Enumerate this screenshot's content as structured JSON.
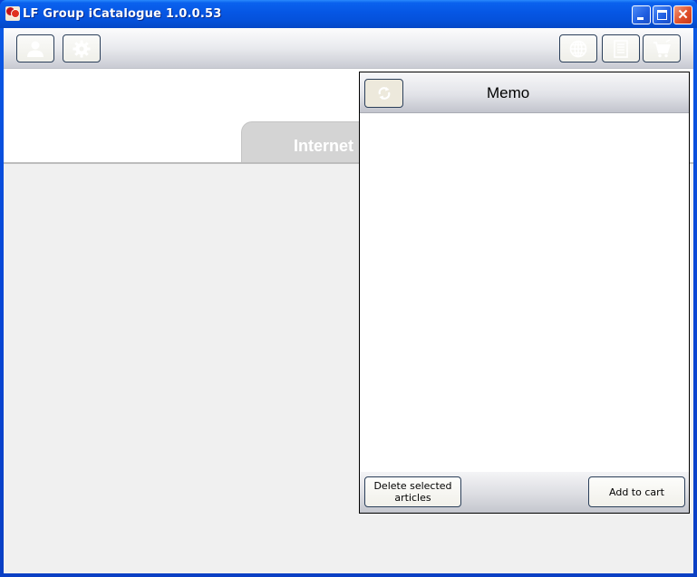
{
  "window": {
    "title": "LF Group iCatalogue 1.0.0.53",
    "controls": {
      "minimize": "minimize",
      "maximize": "maximize",
      "close": "✕"
    }
  },
  "toolbar": {
    "left_buttons": [
      {
        "name": "user",
        "icon": "user-icon"
      },
      {
        "name": "settings",
        "icon": "gear-icon"
      }
    ],
    "right_buttons": [
      {
        "name": "internet",
        "icon": "globe-icon"
      },
      {
        "name": "list",
        "icon": "list-icon"
      },
      {
        "name": "cart",
        "icon": "cart-icon"
      }
    ]
  },
  "tabs": [
    {
      "label": "Internet"
    }
  ],
  "memo": {
    "title": "Memo",
    "refresh_icon": "refresh-icon",
    "items": [],
    "delete_label": "Delete selected articles",
    "add_to_cart_label": "Add to cart"
  }
}
